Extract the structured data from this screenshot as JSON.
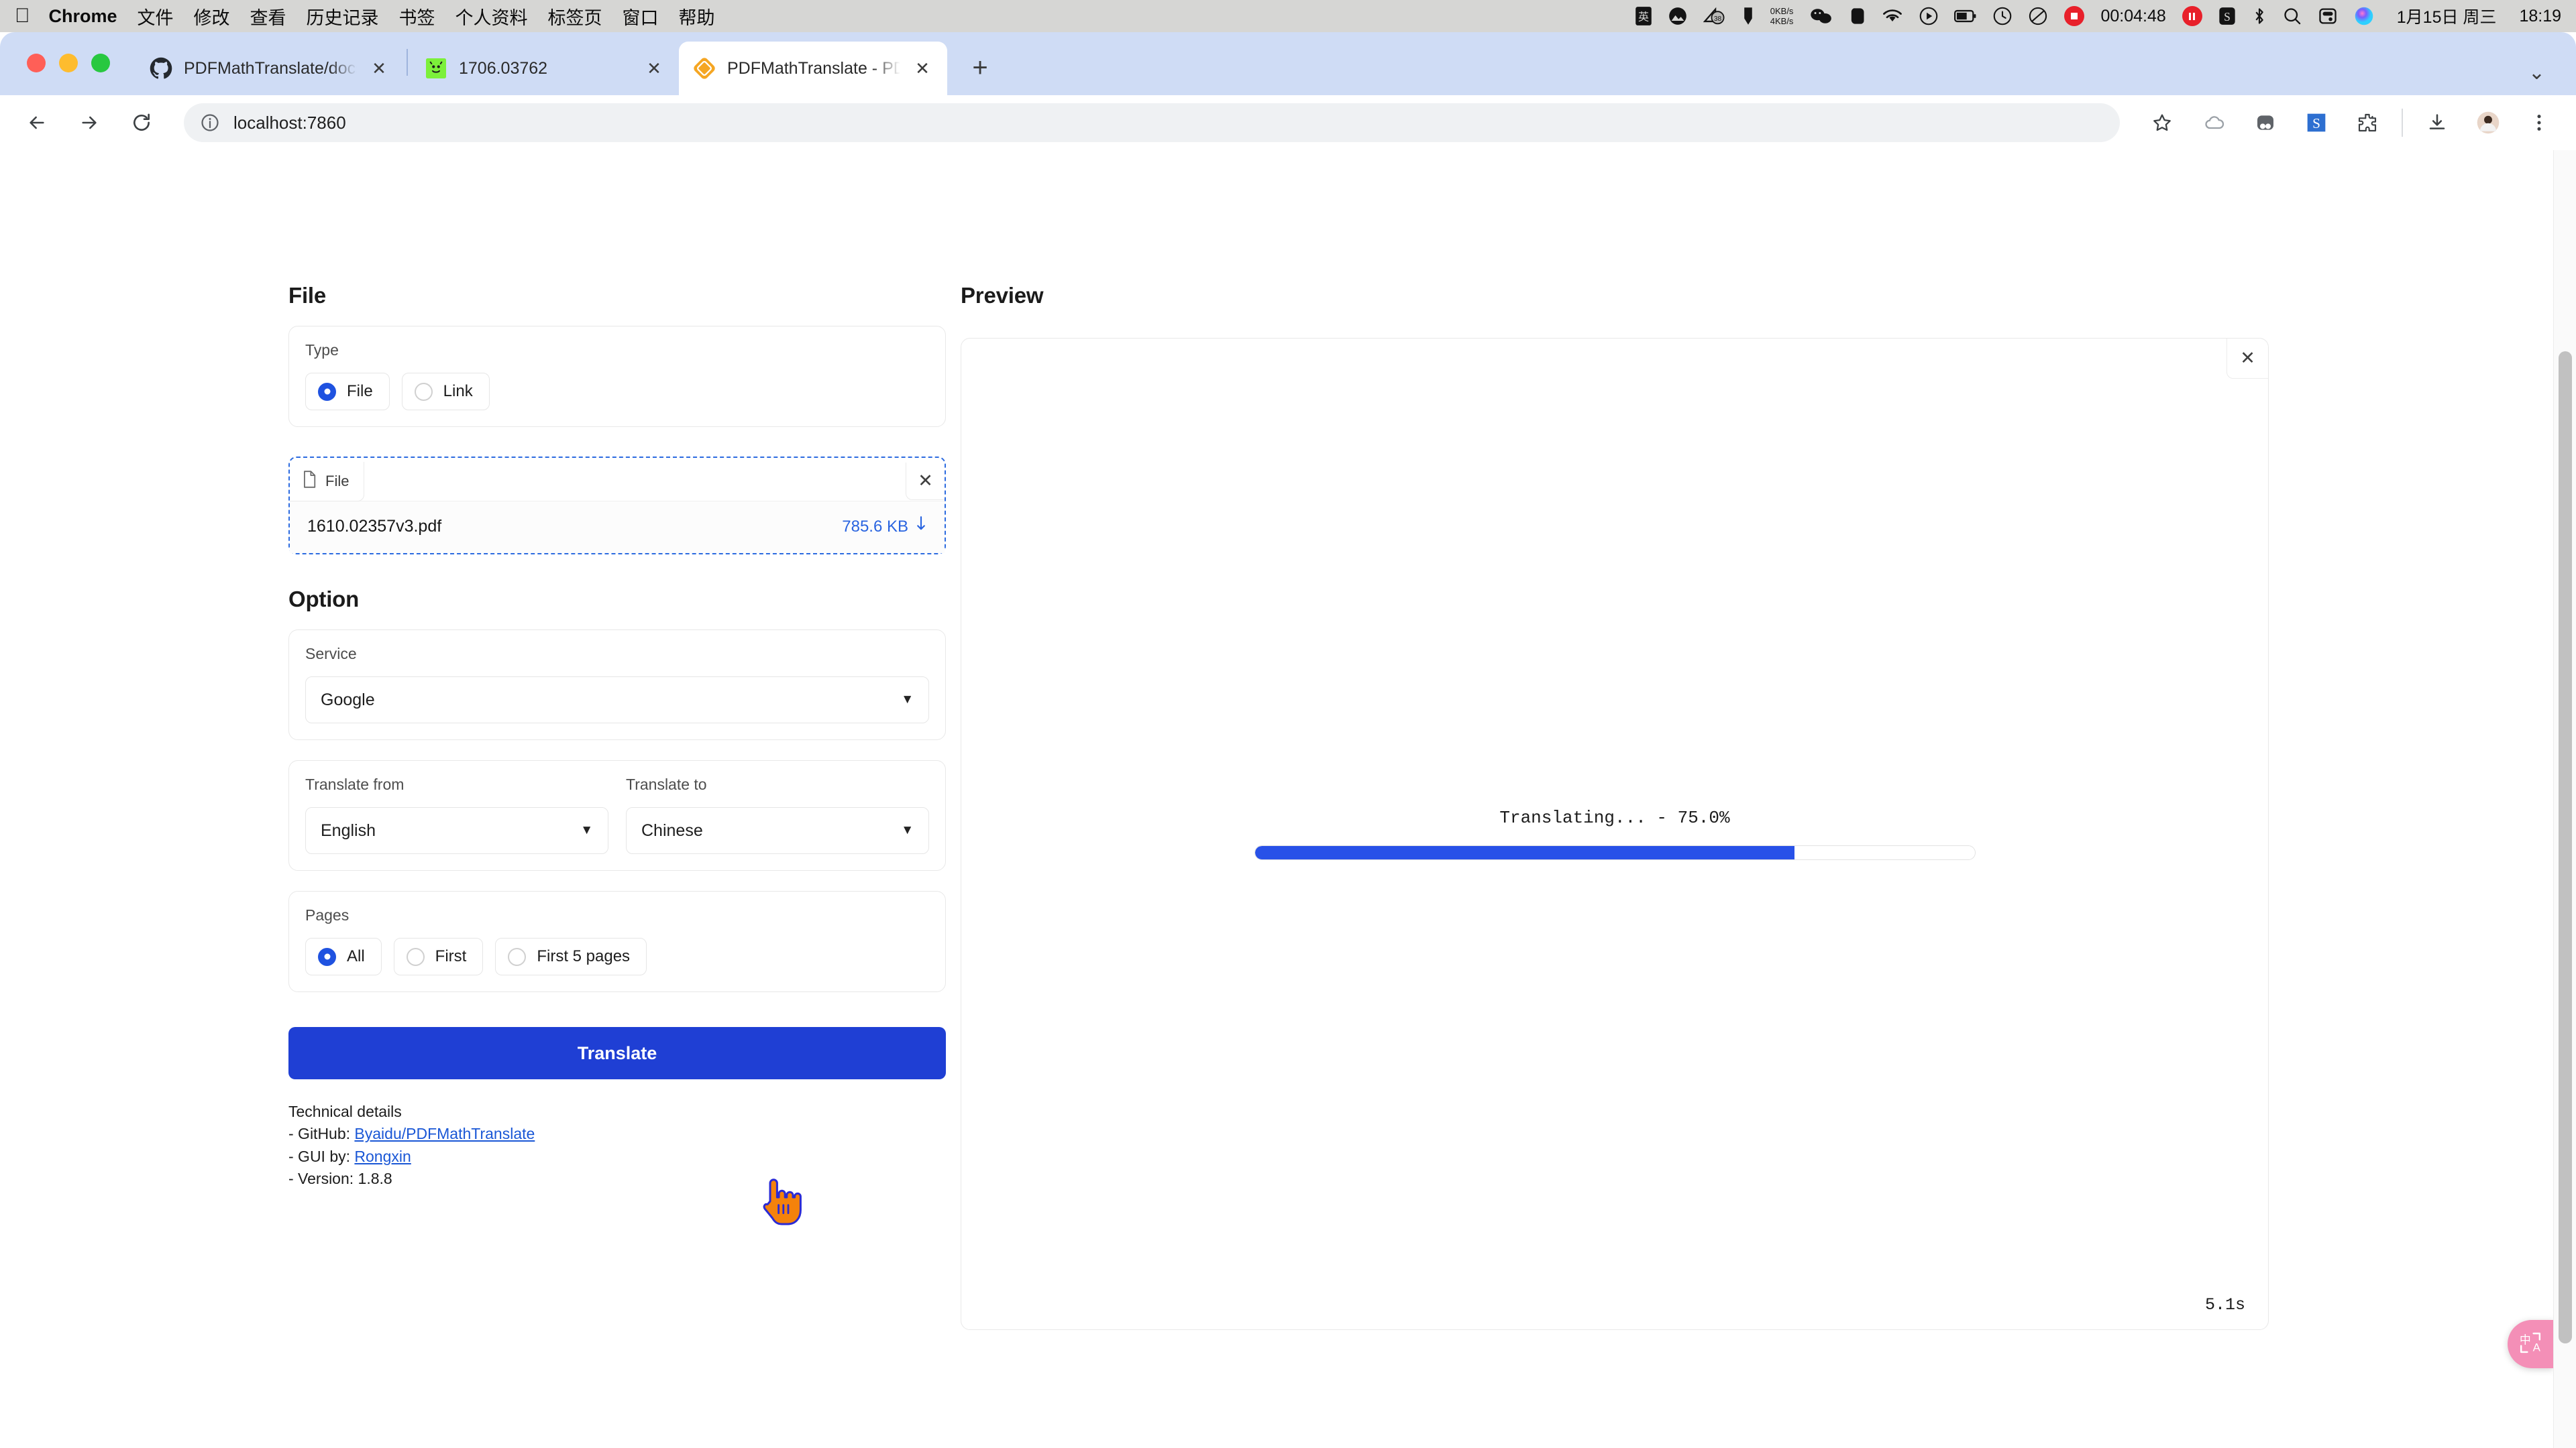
{
  "os_menu": {
    "apple_icon": "apple-icon",
    "items": [
      "Chrome",
      "文件",
      "修改",
      "查看",
      "历史记录",
      "书签",
      "个人资料",
      "标签页",
      "窗口",
      "帮助"
    ],
    "tray": {
      "net_up": "0KB/s",
      "net_down": "4KB/s",
      "badge_count": "38",
      "recording_time": "00:04:48",
      "date": "1月15日 周三",
      "time": "18:19"
    }
  },
  "browser": {
    "tabs": [
      {
        "title": "PDFMathTranslate/docs/READ",
        "favicon": "github-icon",
        "active": false
      },
      {
        "title": "1706.03762",
        "favicon": "arxiv-icon",
        "active": false
      },
      {
        "title": "PDFMathTranslate - PDF Tran",
        "favicon": "pdfmathtranslate-icon",
        "active": true
      }
    ],
    "new_tab_label": "+",
    "address": "localhost:7860",
    "nav": {
      "back": "←",
      "forward": "→",
      "reload": "⟳"
    }
  },
  "page": {
    "file_section": {
      "title": "File",
      "type_label": "Type",
      "type_options": [
        {
          "label": "File",
          "selected": true
        },
        {
          "label": "Link",
          "selected": false
        }
      ],
      "upload": {
        "chip_label": "File",
        "clear_icon": "close-icon",
        "file_name": "1610.02357v3.pdf",
        "file_size": "785.6 KB",
        "download_icon": "download-icon"
      }
    },
    "option_section": {
      "title": "Option",
      "service_label": "Service",
      "service_value": "Google",
      "translate_from_label": "Translate from",
      "translate_from_value": "English",
      "translate_to_label": "Translate to",
      "translate_to_value": "Chinese",
      "pages_label": "Pages",
      "pages_options": [
        {
          "label": "All",
          "selected": true
        },
        {
          "label": "First",
          "selected": false
        },
        {
          "label": "First 5 pages",
          "selected": false
        }
      ]
    },
    "translate_button": "Translate",
    "technical_details": {
      "heading": "Technical details",
      "github_prefix": "- GitHub: ",
      "github_link": "Byaidu/PDFMathTranslate",
      "gui_prefix": "- GUI by: ",
      "gui_link": "Rongxin",
      "version": "- Version: 1.8.8"
    },
    "preview_section": {
      "title": "Preview",
      "close_icon": "close-icon",
      "progress_text": "Translating... - 75.0%",
      "progress_percent": 75,
      "elapsed": "5.1s"
    },
    "extension_bubble": "translate-icon"
  },
  "colors": {
    "accent_blue": "#1f3fd4",
    "progress_blue": "#2851e8",
    "link_blue": "#1a57d6",
    "radio_blue": "#1f52e0",
    "dashed_border": "#2c6be0",
    "tabstrip": "#cfdcf5",
    "menubar": "#d6d6d4",
    "bubble_pink": "#f48fb7"
  }
}
